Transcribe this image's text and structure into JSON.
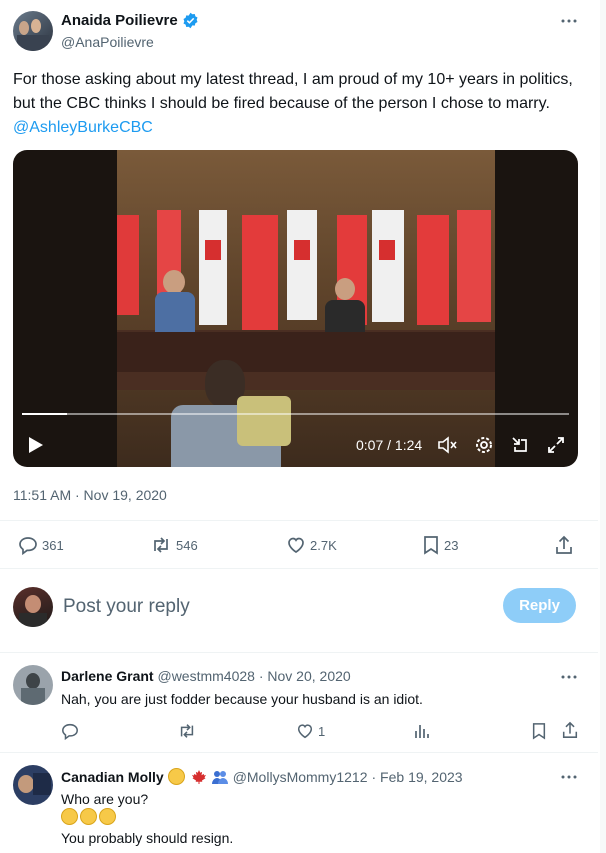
{
  "tweet": {
    "author_name": "Anaida Poilievre",
    "handle": "@AnaPoilievre",
    "text": "For those asking about my latest thread, I am proud of my 10+ years in politics, but the CBC thinks I should be fired because of the person I chose to marry.",
    "mention": "@AshleyBurkeCBC",
    "timestamp": "11:51 AM · Nov 19, 2020",
    "video": {
      "time": "0:07 / 1:24",
      "progress": 0.083
    },
    "stats": {
      "replies": "361",
      "retweets": "546",
      "likes": "2.7K",
      "bookmarks": "23"
    }
  },
  "reply_box": {
    "placeholder": "Post your reply",
    "button_label": "Reply"
  },
  "replies": [
    {
      "name": "Darlene Grant",
      "handle": "@westmm4028",
      "date": "· Nov 20, 2020",
      "text": "Nah, you are just fodder because your husband is an idiot.",
      "likes": "1"
    },
    {
      "name": "Canadian Molly",
      "handle": "@MollysMommy1212",
      "date": "· Feb 19, 2023",
      "line1": "Who are you?",
      "line3": "You probably should resign."
    }
  ],
  "colors": {
    "accent": "#1d9bf0",
    "verified": "#1d9bf0",
    "reply_button": "#8ecdf8"
  }
}
